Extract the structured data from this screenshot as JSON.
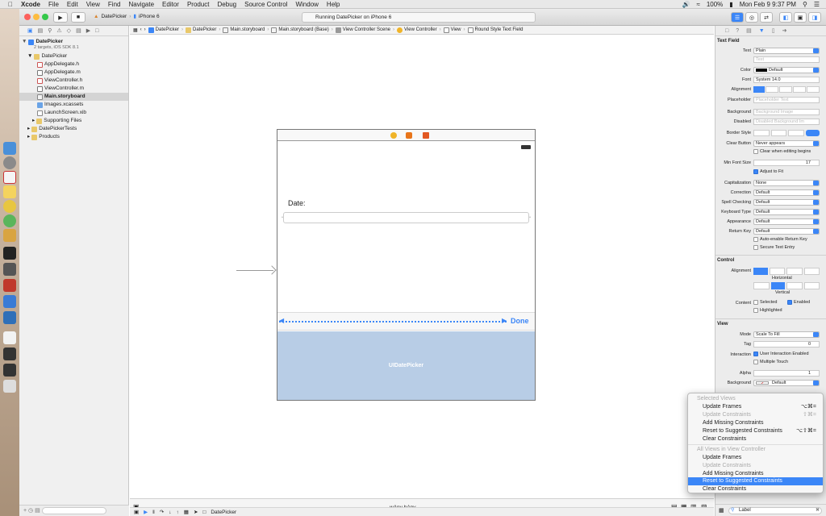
{
  "menubar": {
    "app": "Xcode",
    "items": [
      "File",
      "Edit",
      "View",
      "Find",
      "Navigate",
      "Editor",
      "Product",
      "Debug",
      "Source Control",
      "Window",
      "Help"
    ],
    "battery": "100%",
    "time": "Mon Feb 9  9:37 PM"
  },
  "toolbar": {
    "scheme": "DatePicker",
    "device": "iPhone 6",
    "status": "Running DatePicker on iPhone 6"
  },
  "navigator": {
    "project": "DatePicker",
    "project_sub": "2 targets, iOS SDK 8.1",
    "items": [
      {
        "label": "DatePicker",
        "kind": "folder"
      },
      {
        "label": "AppDelegate.h",
        "kind": "h"
      },
      {
        "label": "AppDelegate.m",
        "kind": "m"
      },
      {
        "label": "ViewController.h",
        "kind": "h"
      },
      {
        "label": "ViewController.m",
        "kind": "m"
      },
      {
        "label": "Main.storyboard",
        "kind": "sb"
      },
      {
        "label": "Images.xcassets",
        "kind": "assets"
      },
      {
        "label": "LaunchScreen.xib",
        "kind": "xib"
      },
      {
        "label": "Supporting Files",
        "kind": "folder"
      },
      {
        "label": "DatePickerTests",
        "kind": "folder"
      },
      {
        "label": "Products",
        "kind": "folder"
      }
    ]
  },
  "jumpbar": [
    "DatePicker",
    "DatePicker",
    "Main.storyboard",
    "Main.storyboard (Base)",
    "View Controller Scene",
    "View Controller",
    "View",
    "Round Style Text Field"
  ],
  "scene": {
    "date_label": "Date:",
    "done": "Done",
    "picker": "UIDatePicker"
  },
  "bottombar": {
    "size_class": "wAny hAny",
    "filter": "DatePicker"
  },
  "inspector": {
    "textfield_title": "Text Field",
    "text_label": "Text",
    "text_value": "Plain",
    "text_placeholder": "Text",
    "color_label": "Color",
    "color_value": "Default",
    "font_label": "Font",
    "font_value": "System 14.0",
    "alignment_label": "Alignment",
    "placeholder_label": "Placeholder",
    "placeholder_value": "Placeholder Text",
    "background_label": "Background",
    "background_value": "Background Image",
    "disabled_label": "Disabled",
    "disabled_value": "Disabled Background Im",
    "border_label": "Border Style",
    "clear_label": "Clear Button",
    "clear_value": "Never appears",
    "clear_editing": "Clear when editing begins",
    "minfont_label": "Min Font Size",
    "minfont_value": "17",
    "adjust": "Adjust to Fit",
    "cap_label": "Capitalization",
    "cap_value": "None",
    "corr_label": "Correction",
    "corr_value": "Default",
    "spell_label": "Spell Checking",
    "spell_value": "Default",
    "kbd_label": "Keyboard Type",
    "kbd_value": "Default",
    "appear_label": "Appearance",
    "appear_value": "Default",
    "return_label": "Return Key",
    "return_value": "Default",
    "auto_enable": "Auto-enable Return Key",
    "secure": "Secure Text Entry",
    "control_title": "Control",
    "horizontal": "Horizontal",
    "vertical": "Vertical",
    "content_label": "Content",
    "selected": "Selected",
    "enabled": "Enabled",
    "highlighted": "Highlighted",
    "view_title": "View",
    "mode_label": "Mode",
    "mode_value": "Scale To Fill",
    "tag_label": "Tag",
    "tag_value": "0",
    "interaction_label": "Interaction",
    "user_interaction": "User Interaction Enabled",
    "multi_touch": "Multiple Touch",
    "alpha_label": "Alpha",
    "alpha_value": "1",
    "vbg_label": "Background",
    "vbg_value": "Default",
    "library_search": "Label"
  },
  "menu": {
    "selected_header": "Selected Views",
    "items1": [
      {
        "label": "Update Frames",
        "sc": "⌥⌘="
      },
      {
        "label": "Update Constraints",
        "sc": "⇧⌘=",
        "disabled": true
      },
      {
        "label": "Add Missing Constraints",
        "sc": ""
      },
      {
        "label": "Reset to Suggested Constraints",
        "sc": "⌥⇧⌘="
      },
      {
        "label": "Clear Constraints",
        "sc": ""
      }
    ],
    "all_header": "All Views in View Controller",
    "items2": [
      {
        "label": "Update Frames"
      },
      {
        "label": "Update Constraints",
        "disabled": true
      },
      {
        "label": "Add Missing Constraints"
      },
      {
        "label": "Reset to Suggested Constraints",
        "selected": true
      },
      {
        "label": "Clear Constraints"
      }
    ]
  }
}
